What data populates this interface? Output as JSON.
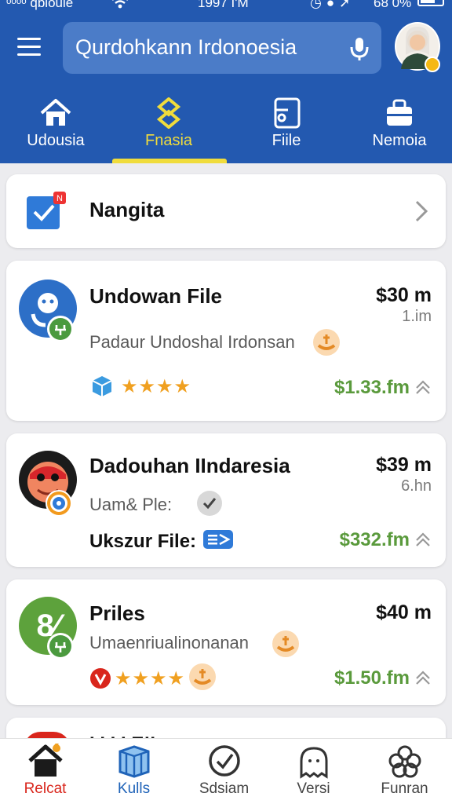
{
  "status_bar": {
    "carrier": "ᵒᵒᵒᵒ qbloule",
    "time": "1997 I'M",
    "battery": "68 0%"
  },
  "header": {
    "search_text": "Qurdohkann Irdonoesia",
    "colors": {
      "primary": "#2359b0",
      "active_tab": "#f0dc3c"
    }
  },
  "tabs": [
    {
      "label": "Udousia",
      "icon": "home-icon"
    },
    {
      "label": "Fnasia",
      "icon": "finance-icon",
      "active": true
    },
    {
      "label": "Fiile",
      "icon": "file-icon"
    },
    {
      "label": "Nemoia",
      "icon": "briefcase-icon"
    }
  ],
  "nav_card": {
    "title": "Nangita",
    "badge": "N"
  },
  "files": [
    {
      "name": "Undowan File",
      "price": "$30 m",
      "size": "1.im",
      "subtitle": "Padaur Undoshal Irdonsan",
      "total": "$1.33.fm",
      "stars": "★★★★"
    },
    {
      "name": "Dadouhan IIndaresia",
      "price": "$39 m",
      "size": "6.hn",
      "subtitle": "Uam& Ple:",
      "label": "Ukszur File:",
      "total": "$332.fm"
    },
    {
      "name": "Priles",
      "price": "$40 m",
      "subtitle": "Umaenriualinonanan",
      "total": "$1.50.fm",
      "stars": "★★★★",
      "avatar_text": "8⁄"
    }
  ],
  "partial_card": {
    "text": "I   I   I   I   E!I"
  },
  "bottom_nav": [
    {
      "label": "Relcat",
      "icon": "home-icon",
      "active": true
    },
    {
      "label": "Kulls",
      "icon": "box-icon"
    },
    {
      "label": "Sdsiam",
      "icon": "check-circle-icon"
    },
    {
      "label": "Versi",
      "icon": "ghost-icon"
    },
    {
      "label": "Funran",
      "icon": "flower-icon"
    }
  ]
}
